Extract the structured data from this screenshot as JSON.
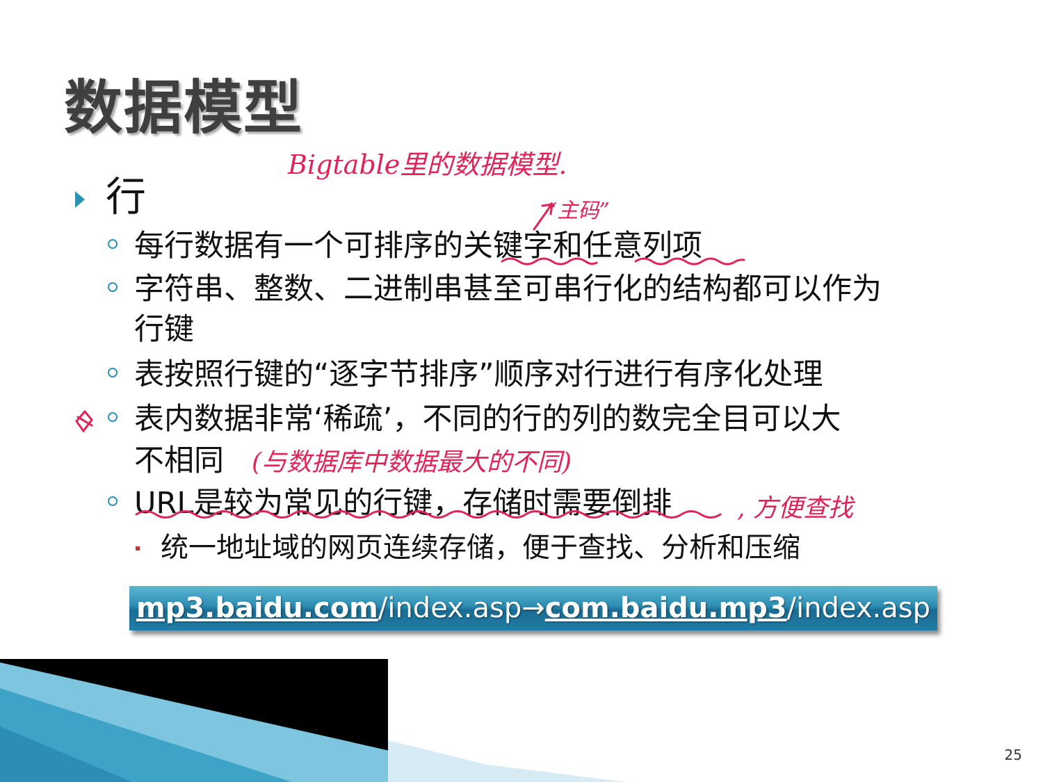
{
  "slide": {
    "title": "数据模型",
    "level1": {
      "label": "行"
    },
    "bullets": [
      {
        "line1": "每行数据有一个可排序的关键字和任意列项",
        "line2": ""
      },
      {
        "line1": "字符串、整数、二进制串甚至可串行化的结构都可以作为",
        "line2": "行键"
      },
      {
        "line1": "表按照行键的“逐字节排序”顺序对行进行有序化处理",
        "line2": ""
      },
      {
        "line1": "表内数据非常‘稀疏’，不同的行的列的数完全目可以大",
        "line2": "不相同"
      },
      {
        "line1": "URL是较为常见的行键，存储时需要倒排",
        "line2": ""
      }
    ],
    "sub_bullet": "统一地址域的网页连续存储，便于查找、分析和压缩",
    "url_example": {
      "part1": "mp3.baidu.com",
      "part2": "/index.asp→",
      "part3": "com.baidu.mp3",
      "part4": "/index.asp"
    },
    "page_number": "25"
  },
  "annotations": {
    "note_title": "Bigtable里的数据模型.",
    "note_key": "“主码”",
    "note_sparse": "(与数据库中数据最大的不同)",
    "note_url": ", 方便查找"
  },
  "colors": {
    "title": "#3f3f3f",
    "bullet_accent": "#2c93b5",
    "sub_bullet": "#c9322e",
    "ink": "#e0245a",
    "url_bar": "#2d8db2"
  }
}
